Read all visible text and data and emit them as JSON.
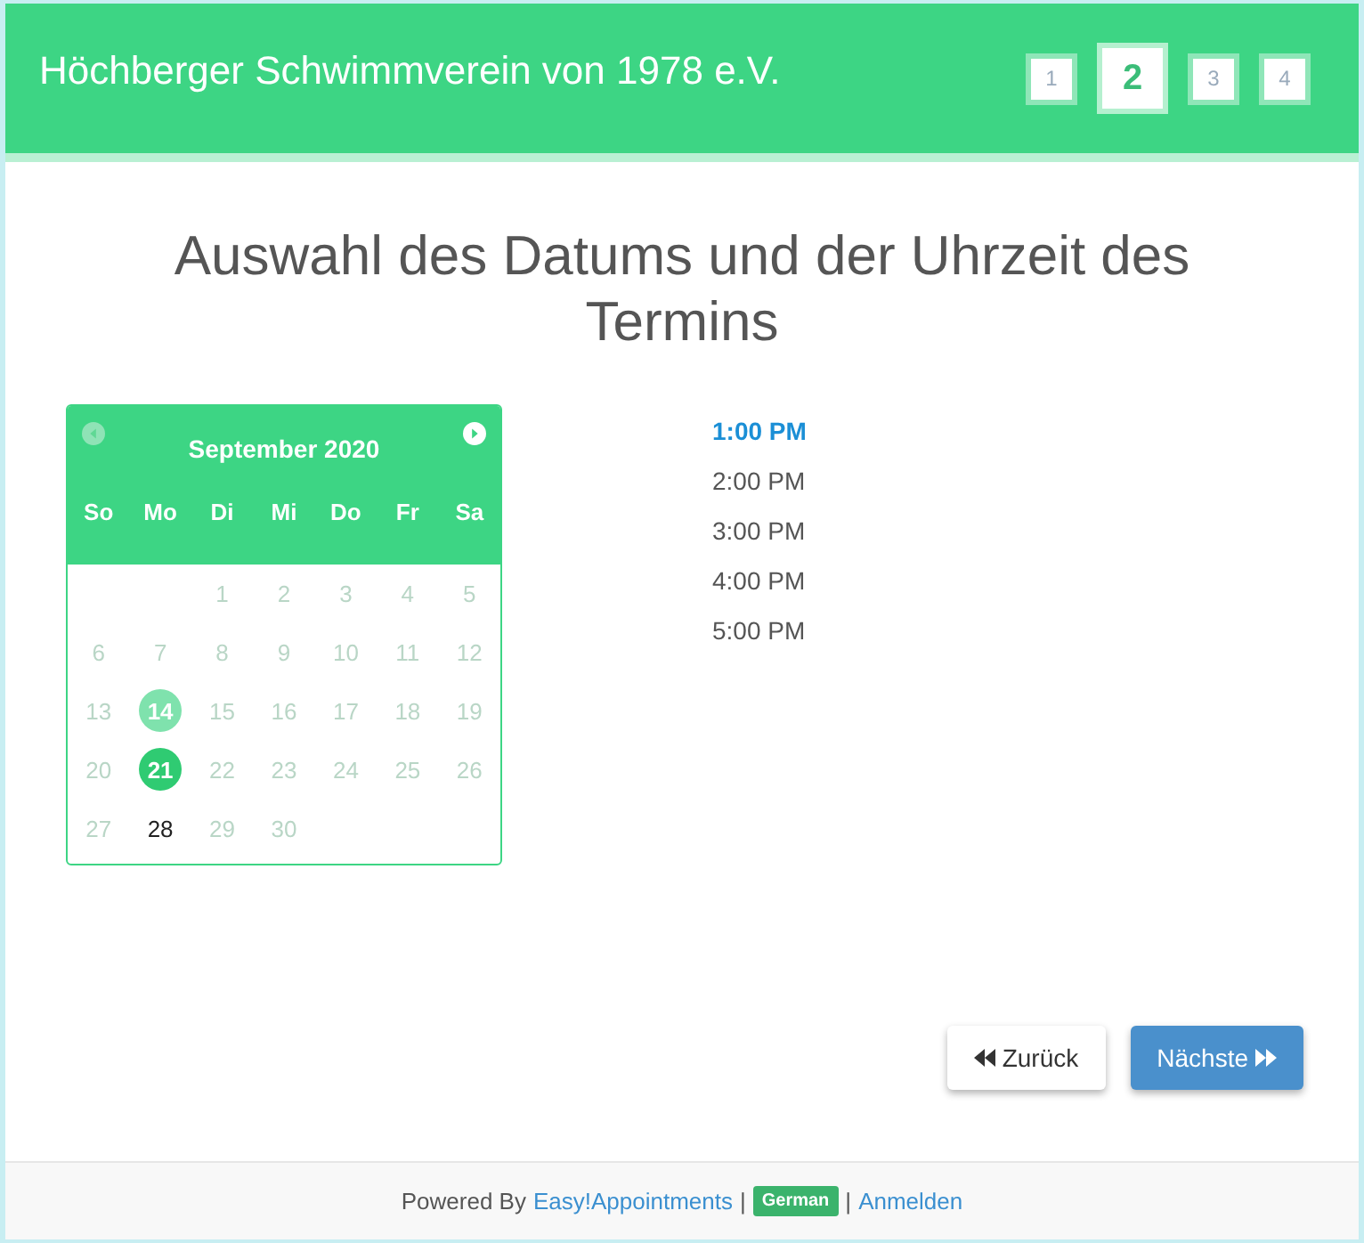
{
  "header": {
    "title": "Höchberger Schwimmverein von 1978 e.V.",
    "steps": [
      {
        "label": "1",
        "selected": false
      },
      {
        "label": "2",
        "selected": true
      },
      {
        "label": "3",
        "selected": false
      },
      {
        "label": "4",
        "selected": false
      }
    ]
  },
  "heading": "Auswahl des Datums und der Uhrzeit des Termins",
  "calendar": {
    "month": "September 2020",
    "prev_disabled": true,
    "next_disabled": false,
    "weekdays": [
      "So",
      "Mo",
      "Di",
      "Mi",
      "Do",
      "Fr",
      "Sa"
    ],
    "days": [
      {
        "day": "1",
        "disabled": true,
        "today": false,
        "selected": false
      },
      {
        "day": "2",
        "disabled": true,
        "today": false,
        "selected": false
      },
      {
        "day": "3",
        "disabled": true,
        "today": false,
        "selected": false
      },
      {
        "day": "4",
        "disabled": true,
        "today": false,
        "selected": false
      },
      {
        "day": "5",
        "disabled": true,
        "today": false,
        "selected": false
      },
      {
        "day": "6",
        "disabled": true,
        "today": false,
        "selected": false
      },
      {
        "day": "7",
        "disabled": true,
        "today": false,
        "selected": false
      },
      {
        "day": "8",
        "disabled": true,
        "today": false,
        "selected": false
      },
      {
        "day": "9",
        "disabled": true,
        "today": false,
        "selected": false
      },
      {
        "day": "10",
        "disabled": true,
        "today": false,
        "selected": false
      },
      {
        "day": "11",
        "disabled": true,
        "today": false,
        "selected": false
      },
      {
        "day": "12",
        "disabled": true,
        "today": false,
        "selected": false
      },
      {
        "day": "13",
        "disabled": true,
        "today": false,
        "selected": false
      },
      {
        "day": "14",
        "disabled": false,
        "today": true,
        "selected": false
      },
      {
        "day": "15",
        "disabled": true,
        "today": false,
        "selected": false
      },
      {
        "day": "16",
        "disabled": true,
        "today": false,
        "selected": false
      },
      {
        "day": "17",
        "disabled": true,
        "today": false,
        "selected": false
      },
      {
        "day": "18",
        "disabled": true,
        "today": false,
        "selected": false
      },
      {
        "day": "19",
        "disabled": true,
        "today": false,
        "selected": false
      },
      {
        "day": "20",
        "disabled": true,
        "today": false,
        "selected": false
      },
      {
        "day": "21",
        "disabled": false,
        "today": false,
        "selected": true
      },
      {
        "day": "22",
        "disabled": true,
        "today": false,
        "selected": false
      },
      {
        "day": "23",
        "disabled": true,
        "today": false,
        "selected": false
      },
      {
        "day": "24",
        "disabled": true,
        "today": false,
        "selected": false
      },
      {
        "day": "25",
        "disabled": true,
        "today": false,
        "selected": false
      },
      {
        "day": "26",
        "disabled": true,
        "today": false,
        "selected": false
      },
      {
        "day": "27",
        "disabled": true,
        "today": false,
        "selected": false
      },
      {
        "day": "28",
        "disabled": false,
        "today": false,
        "selected": false
      },
      {
        "day": "29",
        "disabled": true,
        "today": false,
        "selected": false
      },
      {
        "day": "30",
        "disabled": true,
        "today": false,
        "selected": false
      }
    ]
  },
  "times": [
    {
      "label": "1:00 PM",
      "selected": true
    },
    {
      "label": "2:00 PM",
      "selected": false
    },
    {
      "label": "3:00 PM",
      "selected": false
    },
    {
      "label": "4:00 PM",
      "selected": false
    },
    {
      "label": "5:00 PM",
      "selected": false
    }
  ],
  "buttons": {
    "back": "Zurück",
    "next": "Nächste"
  },
  "footer": {
    "powered_by": "Powered By",
    "brand_link": "Easy!Appointments",
    "separator_1": "|",
    "language": "German",
    "separator_2": "|",
    "login_link": "Anmelden"
  }
}
